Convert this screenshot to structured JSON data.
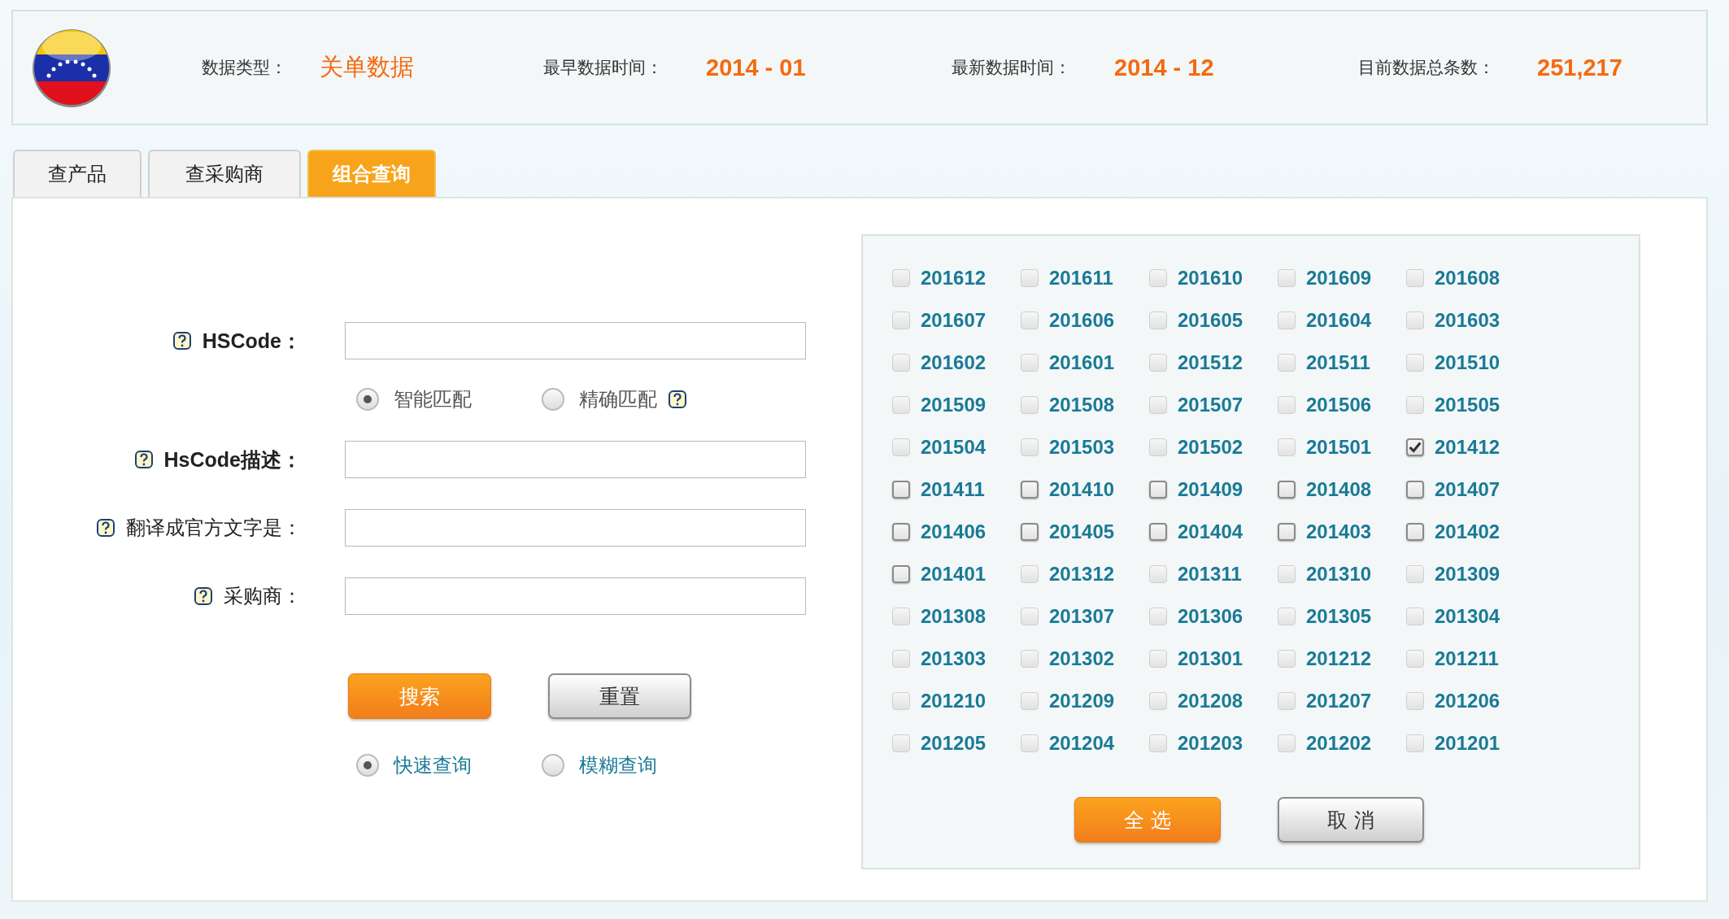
{
  "header": {
    "stats": [
      {
        "label": "数据类型：",
        "value": "关单数据",
        "kind": "text"
      },
      {
        "label": "最早数据时间：",
        "value": "2014 - 01",
        "kind": "number"
      },
      {
        "label": "最新数据时间：",
        "value": "2014 - 12",
        "kind": "number"
      },
      {
        "label": "目前数据总条数：",
        "value": "251,217",
        "kind": "number"
      }
    ]
  },
  "tabs": [
    {
      "label": "查产品",
      "selected": false
    },
    {
      "label": "查采购商",
      "selected": false
    },
    {
      "label": "组合查询",
      "selected": true
    }
  ],
  "form": {
    "fields": [
      {
        "label": "HSCode：",
        "bold": true,
        "match_options": [
          {
            "label": "智能匹配",
            "selected": true
          },
          {
            "label": "精确匹配",
            "selected": false
          }
        ]
      },
      {
        "label": "HsCode描述：",
        "bold": true
      },
      {
        "label": "翻译成官方文字是：",
        "bold": false
      },
      {
        "label": "采购商：",
        "bold": false
      }
    ],
    "buttons": [
      {
        "label": "搜索",
        "kind": "primary"
      },
      {
        "label": "重置",
        "kind": "secondary"
      }
    ],
    "query_modes": [
      {
        "label": "快速查询",
        "selected": true
      },
      {
        "label": "模糊查询",
        "selected": false
      }
    ]
  },
  "months": [
    {
      "label": "201612",
      "checked": false,
      "disabled": true
    },
    {
      "label": "201611",
      "checked": false,
      "disabled": true
    },
    {
      "label": "201610",
      "checked": false,
      "disabled": true
    },
    {
      "label": "201609",
      "checked": false,
      "disabled": true
    },
    {
      "label": "201608",
      "checked": false,
      "disabled": true
    },
    {
      "label": "201607",
      "checked": false,
      "disabled": true
    },
    {
      "label": "201606",
      "checked": false,
      "disabled": true
    },
    {
      "label": "201605",
      "checked": false,
      "disabled": true
    },
    {
      "label": "201604",
      "checked": false,
      "disabled": true
    },
    {
      "label": "201603",
      "checked": false,
      "disabled": true
    },
    {
      "label": "201602",
      "checked": false,
      "disabled": true
    },
    {
      "label": "201601",
      "checked": false,
      "disabled": true
    },
    {
      "label": "201512",
      "checked": false,
      "disabled": true
    },
    {
      "label": "201511",
      "checked": false,
      "disabled": true
    },
    {
      "label": "201510",
      "checked": false,
      "disabled": true
    },
    {
      "label": "201509",
      "checked": false,
      "disabled": true
    },
    {
      "label": "201508",
      "checked": false,
      "disabled": true
    },
    {
      "label": "201507",
      "checked": false,
      "disabled": true
    },
    {
      "label": "201506",
      "checked": false,
      "disabled": true
    },
    {
      "label": "201505",
      "checked": false,
      "disabled": true
    },
    {
      "label": "201504",
      "checked": false,
      "disabled": true
    },
    {
      "label": "201503",
      "checked": false,
      "disabled": true
    },
    {
      "label": "201502",
      "checked": false,
      "disabled": true
    },
    {
      "label": "201501",
      "checked": false,
      "disabled": true
    },
    {
      "label": "201412",
      "checked": true,
      "disabled": false
    },
    {
      "label": "201411",
      "checked": false,
      "disabled": false
    },
    {
      "label": "201410",
      "checked": false,
      "disabled": false
    },
    {
      "label": "201409",
      "checked": false,
      "disabled": false
    },
    {
      "label": "201408",
      "checked": false,
      "disabled": false
    },
    {
      "label": "201407",
      "checked": false,
      "disabled": false
    },
    {
      "label": "201406",
      "checked": false,
      "disabled": false
    },
    {
      "label": "201405",
      "checked": false,
      "disabled": false
    },
    {
      "label": "201404",
      "checked": false,
      "disabled": false
    },
    {
      "label": "201403",
      "checked": false,
      "disabled": false
    },
    {
      "label": "201402",
      "checked": false,
      "disabled": false
    },
    {
      "label": "201401",
      "checked": false,
      "disabled": false
    },
    {
      "label": "201312",
      "checked": false,
      "disabled": true
    },
    {
      "label": "201311",
      "checked": false,
      "disabled": true
    },
    {
      "label": "201310",
      "checked": false,
      "disabled": true
    },
    {
      "label": "201309",
      "checked": false,
      "disabled": true
    },
    {
      "label": "201308",
      "checked": false,
      "disabled": true
    },
    {
      "label": "201307",
      "checked": false,
      "disabled": true
    },
    {
      "label": "201306",
      "checked": false,
      "disabled": true
    },
    {
      "label": "201305",
      "checked": false,
      "disabled": true
    },
    {
      "label": "201304",
      "checked": false,
      "disabled": true
    },
    {
      "label": "201303",
      "checked": false,
      "disabled": true
    },
    {
      "label": "201302",
      "checked": false,
      "disabled": true
    },
    {
      "label": "201301",
      "checked": false,
      "disabled": true
    },
    {
      "label": "201212",
      "checked": false,
      "disabled": true
    },
    {
      "label": "201211",
      "checked": false,
      "disabled": true
    },
    {
      "label": "201210",
      "checked": false,
      "disabled": true
    },
    {
      "label": "201209",
      "checked": false,
      "disabled": true
    },
    {
      "label": "201208",
      "checked": false,
      "disabled": true
    },
    {
      "label": "201207",
      "checked": false,
      "disabled": true
    },
    {
      "label": "201206",
      "checked": false,
      "disabled": true
    },
    {
      "label": "201205",
      "checked": false,
      "disabled": true
    },
    {
      "label": "201204",
      "checked": false,
      "disabled": true
    },
    {
      "label": "201203",
      "checked": false,
      "disabled": true
    },
    {
      "label": "201202",
      "checked": false,
      "disabled": true
    },
    {
      "label": "201201",
      "checked": false,
      "disabled": true
    }
  ],
  "month_buttons": [
    {
      "label": "全 选",
      "kind": "primary"
    },
    {
      "label": "取 消",
      "kind": "secondary"
    }
  ]
}
